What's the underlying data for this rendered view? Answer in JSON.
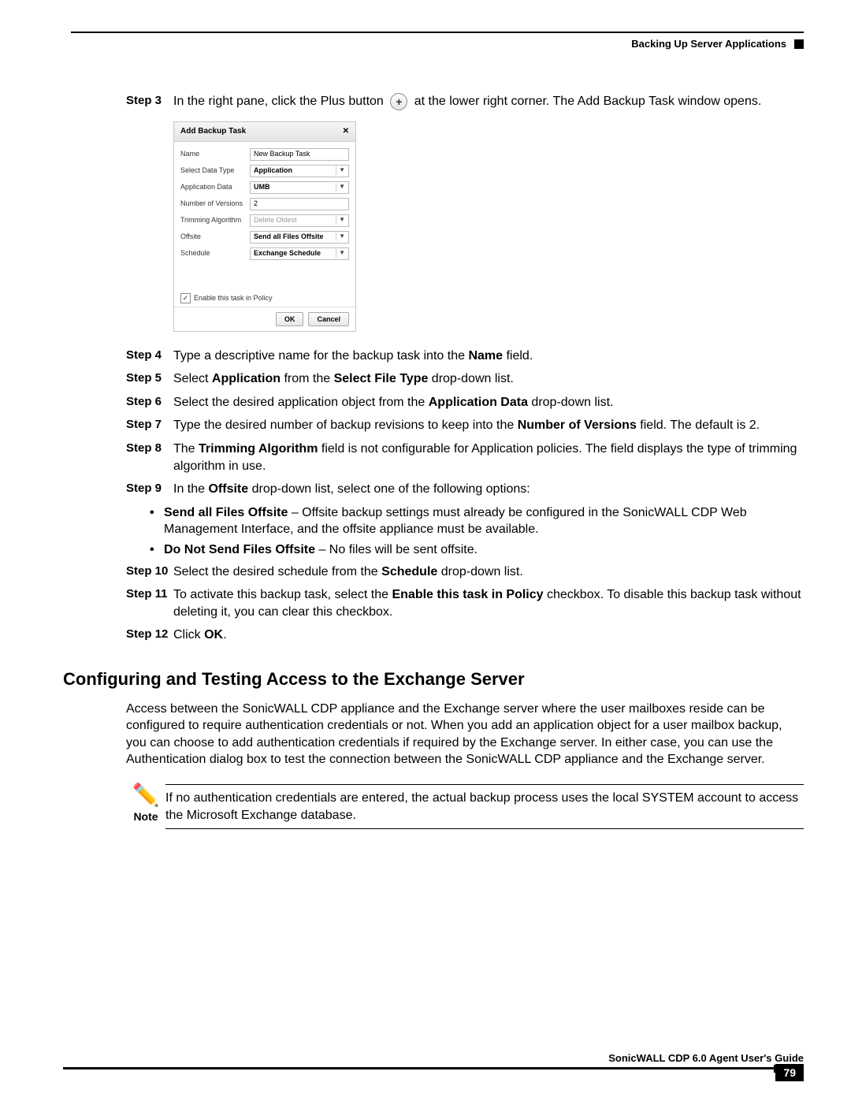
{
  "header": {
    "section": "Backing Up Server Applications"
  },
  "steps": {
    "s3": {
      "label": "Step 3"
    },
    "s3_text_a": "In the right pane, click the Plus button",
    "s3_text_b": "at the lower right corner. The Add Backup Task window opens.",
    "s4": {
      "label": "Step 4",
      "text_a": "Type a descriptive name for the backup task into the ",
      "bold_a": "Name",
      "text_b": " field."
    },
    "s5": {
      "label": "Step 5",
      "text_a": "Select ",
      "bold_a": "Application",
      "text_b": " from the ",
      "bold_b": "Select File Type",
      "text_c": " drop-down list."
    },
    "s6": {
      "label": "Step 6",
      "text_a": "Select the desired application object from the ",
      "bold_a": "Application Data",
      "text_b": " drop-down list."
    },
    "s7": {
      "label": "Step 7",
      "text_a": "Type the desired number of backup revisions to keep into the ",
      "bold_a": "Number of Versions",
      "text_b": " field. The default is 2."
    },
    "s8": {
      "label": "Step 8",
      "text_a": "The ",
      "bold_a": "Trimming Algorithm",
      "text_b": " field is not configurable for Application policies. The field displays the type of trimming algorithm in use."
    },
    "s9": {
      "label": "Step 9",
      "text_a": "In the ",
      "bold_a": "Offsite",
      "text_b": " drop-down list, select one of the following options:"
    },
    "bullet1": {
      "bold": "Send all Files Offsite",
      "text": " – Offsite backup settings must already be configured in the SonicWALL CDP Web Management Interface, and the offsite appliance must be available."
    },
    "bullet2": {
      "bold": "Do Not Send Files Offsite",
      "text": " – No files will be sent offsite."
    },
    "s10": {
      "label": "Step 10",
      "text_a": "Select the desired schedule from the ",
      "bold_a": "Schedule",
      "text_b": " drop-down list."
    },
    "s11": {
      "label": "Step 11",
      "text_a": "To activate this backup task, select the ",
      "bold_a": "Enable this task in Policy",
      "text_b": " checkbox. To disable this backup task without deleting it, you can clear this checkbox."
    },
    "s12": {
      "label": "Step 12",
      "text_a": "Click ",
      "bold_a": "OK",
      "text_b": "."
    }
  },
  "dialog": {
    "title": "Add Backup Task",
    "name_label": "Name",
    "name_value": "New Backup Task",
    "type_label": "Select Data Type",
    "type_value": "Application",
    "appdata_label": "Application Data",
    "appdata_value": "UMB",
    "versions_label": "Number of Versions",
    "versions_value": "2",
    "trim_label": "Trimming Algorithm",
    "trim_value": "Delete Oldest",
    "offsite_label": "Offsite",
    "offsite_value": "Send all Files Offsite",
    "schedule_label": "Schedule",
    "schedule_value": "Exchange Schedule",
    "enable_label": "Enable this task in Policy",
    "ok": "OK",
    "cancel": "Cancel"
  },
  "section2": {
    "title": "Configuring and Testing Access to the Exchange Server",
    "para": "Access between the SonicWALL CDP appliance and the Exchange server where the user mailboxes reside can be configured to require authentication credentials or not. When you add an application object for a user mailbox backup, you can choose to add authentication credentials if required by the Exchange server. In either case, you can use the Authentication dialog box to test the connection between the SonicWALL CDP appliance and the Exchange server."
  },
  "note": {
    "label": "Note",
    "text": "If no authentication credentials are entered, the actual backup process uses the local SYSTEM account to access the Microsoft Exchange database."
  },
  "footer": {
    "title": "SonicWALL CDP 6.0 Agent User's Guide",
    "page": "79"
  }
}
